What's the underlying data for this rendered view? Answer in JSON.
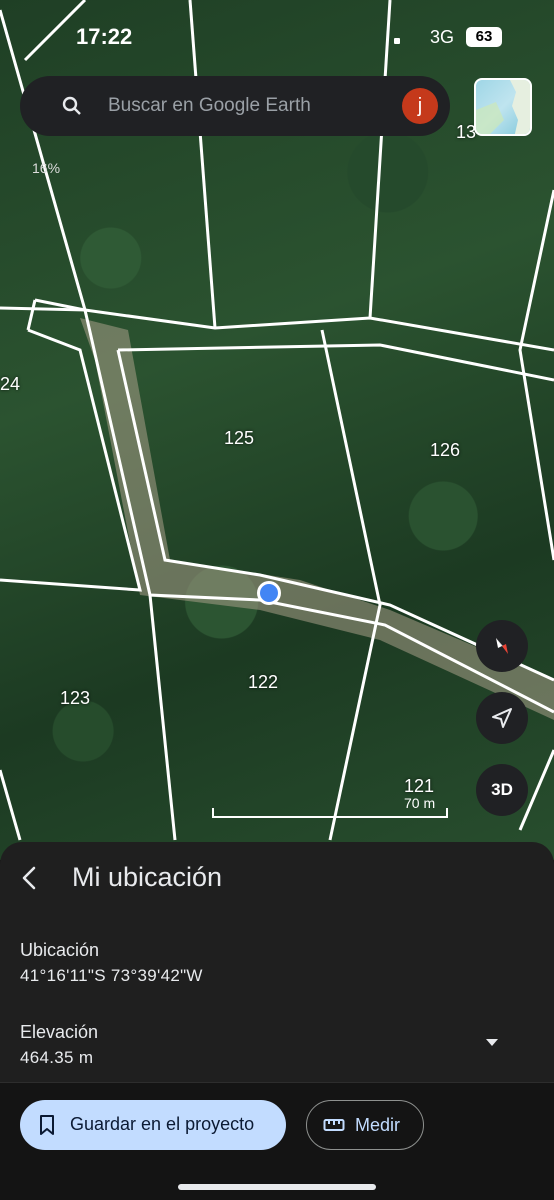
{
  "status_bar": {
    "time": "17:22",
    "network": "3G",
    "battery": "63"
  },
  "search": {
    "placeholder": "Buscar en Google Earth",
    "avatar_letter": "j"
  },
  "map": {
    "zoom_percent": "16%",
    "parcel_labels": [
      "24",
      "125",
      "126",
      "122",
      "123",
      "121",
      "13"
    ],
    "scale": "70 m",
    "btn_3d": "3D"
  },
  "panel": {
    "title": "Mi ubicación",
    "location_label": "Ubicación",
    "location_value": "41°16'11\"S 73°39'42\"W",
    "elevation_label": "Elevación",
    "elevation_value": "464.35 m",
    "save_button": "Guardar en el proyecto",
    "measure_button": "Medir"
  },
  "colors": {
    "accent": "#c2dcff",
    "location_dot": "#4285f4",
    "avatar": "#c5391b"
  }
}
